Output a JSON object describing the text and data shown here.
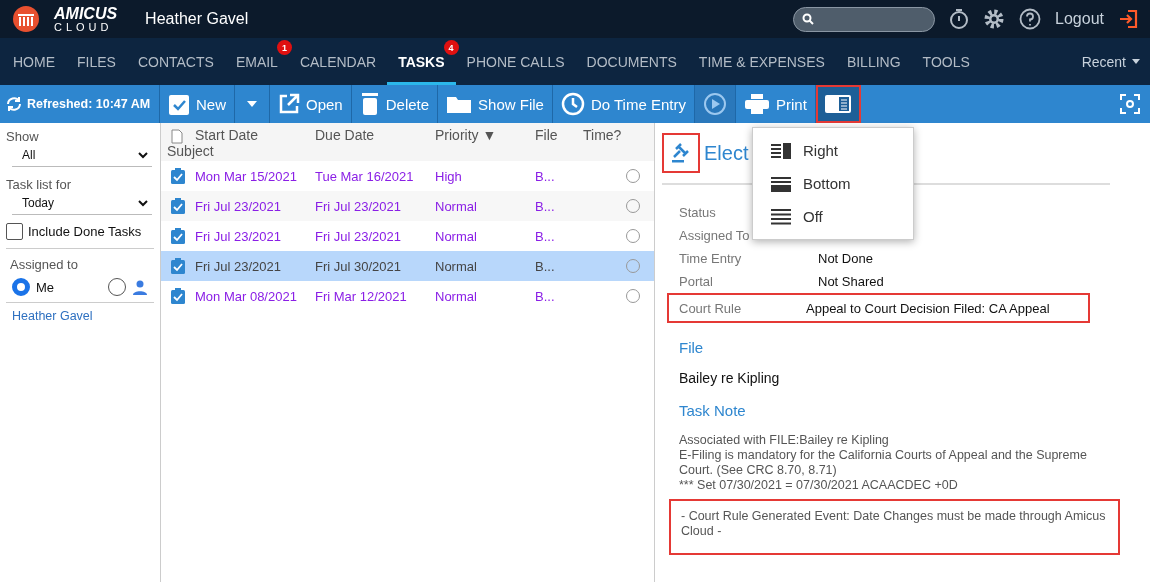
{
  "header": {
    "logo_top": "AMICUS",
    "logo_bottom": "CLOUD",
    "user": "Heather Gavel",
    "logout": "Logout"
  },
  "nav": {
    "items": [
      {
        "label": "HOME",
        "selected": false
      },
      {
        "label": "FILES",
        "selected": false
      },
      {
        "label": "CONTACTS",
        "selected": false
      },
      {
        "label": "EMAIL",
        "selected": false,
        "badge": "1"
      },
      {
        "label": "CALENDAR",
        "selected": false
      },
      {
        "label": "TASKS",
        "selected": true,
        "badge": "4"
      },
      {
        "label": "PHONE CALLS",
        "selected": false
      },
      {
        "label": "DOCUMENTS",
        "selected": false
      },
      {
        "label": "TIME & EXPENSES",
        "selected": false
      },
      {
        "label": "BILLING",
        "selected": false
      },
      {
        "label": "TOOLS",
        "selected": false
      }
    ],
    "recent": "Recent"
  },
  "toolbar": {
    "refreshed": "Refreshed: 10:47 AM",
    "buttons": [
      {
        "kind": "new",
        "label": "New"
      },
      {
        "kind": "open",
        "label": "Open"
      },
      {
        "kind": "delete",
        "label": "Delete"
      },
      {
        "kind": "folder",
        "label": "Show File"
      },
      {
        "kind": "clock",
        "label": "Do Time Entry"
      },
      {
        "kind": "play"
      },
      {
        "kind": "print",
        "label": "Print"
      },
      {
        "kind": "layout",
        "selected": true
      }
    ]
  },
  "sidebar": {
    "show_label": "Show",
    "show_value": "All",
    "tasklist_label": "Task list for",
    "tasklist_value": "Today",
    "include_done": {
      "label": "Include Done Tasks",
      "checked": false
    },
    "assigned_label": "Assigned to",
    "options": [
      {
        "label": "Me",
        "selected": true
      },
      {
        "kind": "person",
        "selected": false
      }
    ],
    "assignee": "Heather Gavel"
  },
  "table": {
    "columns": [
      "Subject",
      "Start Date",
      "Due Date",
      "Priority ▼",
      "File",
      "Time?"
    ],
    "rows": [
      {
        "start": "Mon Mar 15/2021",
        "due": "Tue Mar 16/2021",
        "priority": "High",
        "file": "B...",
        "selected": false
      },
      {
        "start": "Fri Jul 23/2021",
        "due": "Fri Jul 23/2021",
        "priority": "Normal",
        "file": "B...",
        "selected": false
      },
      {
        "start": "Fri Jul 23/2021",
        "due": "Fri Jul 23/2021",
        "priority": "Normal",
        "file": "B...",
        "selected": false
      },
      {
        "start": "Fri Jul 23/2021",
        "due": "Fri Jul 30/2021",
        "priority": "Normal",
        "file": "B...",
        "selected": true
      },
      {
        "start": "Mon Mar 08/2021",
        "due": "Fri Mar 12/2021",
        "priority": "Normal",
        "file": "B...",
        "selected": false
      }
    ]
  },
  "detail": {
    "title": "Elect",
    "fields": [
      {
        "label": "Status"
      },
      {
        "label": "Assigned To"
      },
      {
        "label": "Time Entry",
        "value": "Not Done"
      },
      {
        "label": "Portal",
        "value": "Not Shared"
      },
      {
        "label": "Court Rule",
        "value": "Appeal to Court Decision Filed: CA Appeal",
        "highlighted": true
      }
    ],
    "file_heading": "File",
    "file": "Bailey re Kipling",
    "note_heading": "Task Note",
    "note_lines": [
      "Associated with FILE:Bailey re Kipling",
      "E-Filing is mandatory for the California Courts of Appeal and the Supreme Court. (See CRC 8.70, 8.71)",
      "*** Set 07/30/2021 = 07/30/2021 ACAACDEC +0D"
    ],
    "note_footer": "- Court Rule Generated Event: Date Changes must be made through Amicus Cloud -"
  },
  "layout_menu": [
    {
      "kind": "right",
      "label": "Right"
    },
    {
      "kind": "bottom",
      "label": "Bottom"
    },
    {
      "kind": "off",
      "label": "Off"
    }
  ]
}
